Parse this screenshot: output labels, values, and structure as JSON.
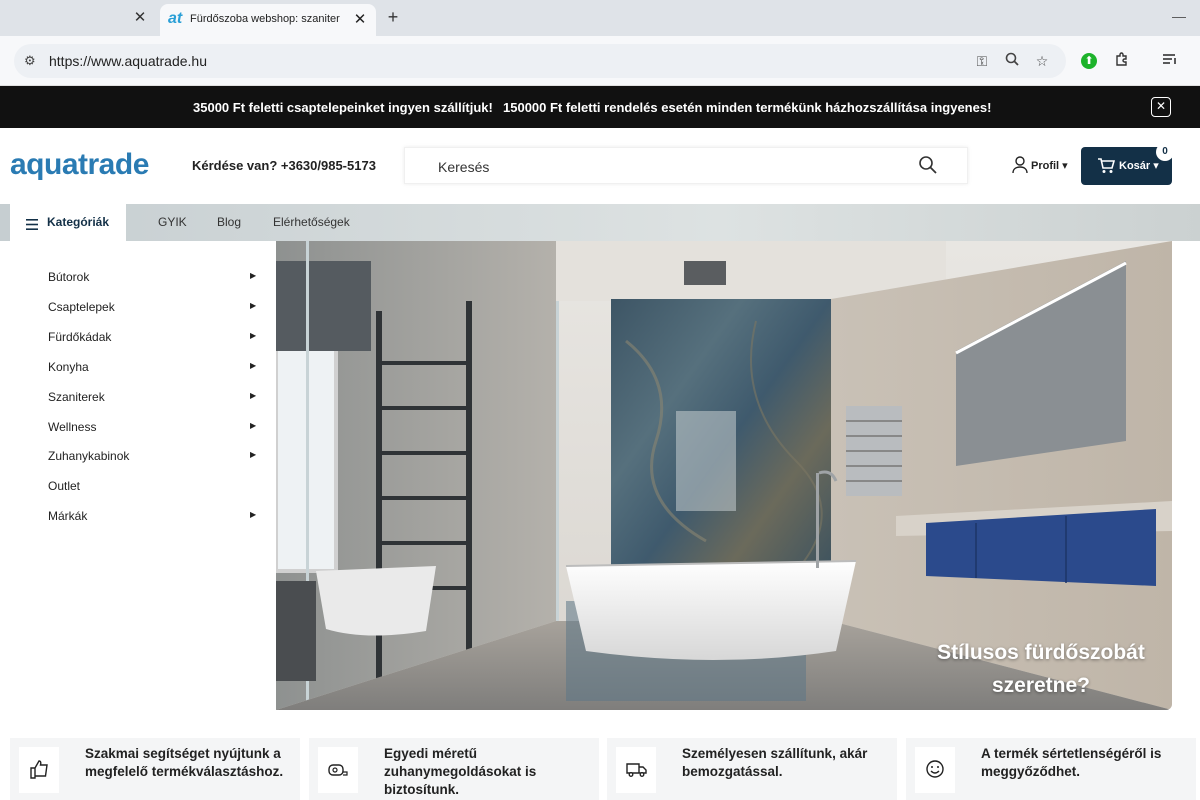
{
  "browser": {
    "active_tab_title": "Fürdőszoba webshop: szaniter, zuhany",
    "favicon_text": "at",
    "url": "https://www.aquatrade.hu"
  },
  "promo": {
    "message_1": "35000 Ft feletti csaptelepeinket ingyen szállítjuk!",
    "message_2": "150000 Ft feletti rendelés esetén minden termékünk házhozszállítása ingyenes!",
    "close_symbol": "✕"
  },
  "header": {
    "logo": "aquatrade",
    "phone": "Kérdése van? +3630/985-5173",
    "search_placeholder": "Keresés",
    "profile_label": "Profil ▾",
    "cart_label": "Kosár ▾",
    "cart_count": "0"
  },
  "nav": {
    "categories_label": "Kategóriák",
    "links": [
      "GYIK",
      "Blog",
      "Elérhetőségek"
    ]
  },
  "categories": [
    {
      "label": "Bútorok",
      "has_submenu": true
    },
    {
      "label": "Csaptelepek",
      "has_submenu": true
    },
    {
      "label": "Fürdőkádak",
      "has_submenu": true
    },
    {
      "label": "Konyha",
      "has_submenu": true
    },
    {
      "label": "Szaniterek",
      "has_submenu": true
    },
    {
      "label": "Wellness",
      "has_submenu": true
    },
    {
      "label": "Zuhanykabinok",
      "has_submenu": true
    },
    {
      "label": "Outlet",
      "has_submenu": false
    },
    {
      "label": "Márkák",
      "has_submenu": true
    }
  ],
  "hero": {
    "caption_line_1": "Stílusos fürdőszobát",
    "caption_line_2": "szeretne?"
  },
  "features": [
    {
      "icon": "thumbs-up-icon",
      "text": "Szakmai segítséget nyújtunk a megfelelő termékválasztáshoz."
    },
    {
      "icon": "tape-measure-icon",
      "text": "Egyedi méretű zuhanymegoldásokat is biztosítunk."
    },
    {
      "icon": "delivery-truck-icon",
      "text": "Személyesen szállítunk, akár bemozgatással."
    },
    {
      "icon": "smiley-icon",
      "text": "A termék sértetlenségéről is meggyőződhet."
    }
  ],
  "colors": {
    "brand_blue": "#2a7bb3",
    "navy": "#133047",
    "promo_bg": "#111111"
  }
}
